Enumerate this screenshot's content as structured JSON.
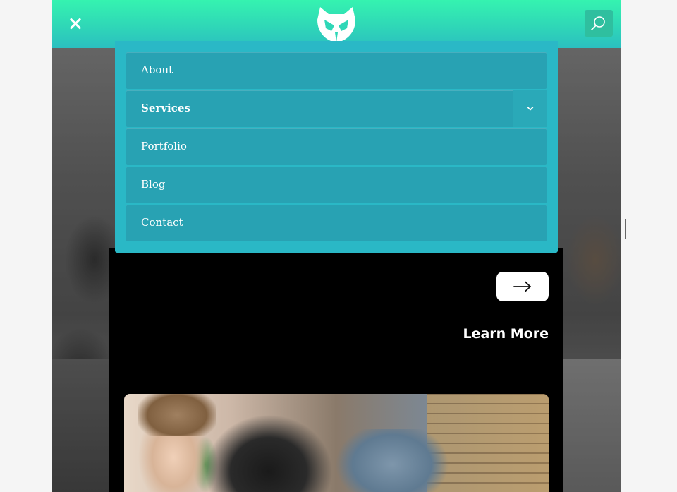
{
  "header": {
    "close_icon": "close-icon",
    "logo_icon": "mask-logo-icon",
    "search_icon": "search-icon",
    "gradient_top": "#35f3b0",
    "gradient_bottom": "#2bbfc0"
  },
  "menu": {
    "items": [
      {
        "label": "About"
      },
      {
        "label": "Services",
        "has_submenu": true
      },
      {
        "label": "Portfolio"
      },
      {
        "label": "Blog"
      },
      {
        "label": "Contact"
      }
    ],
    "expand_icon": "chevron-down-icon",
    "background": "#2ab8c6",
    "item_background": "#28a2b3"
  },
  "card": {
    "arrow_icon": "arrow-right-icon",
    "learn_more": "Learn More"
  }
}
